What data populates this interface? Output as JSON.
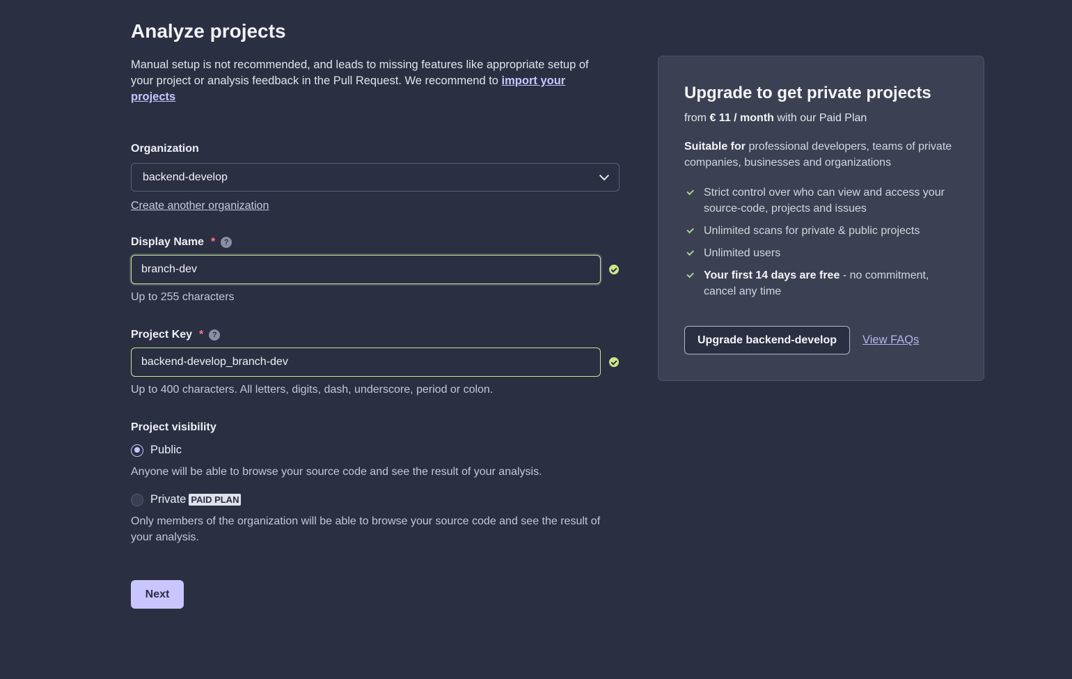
{
  "header": {
    "title": "Analyze projects"
  },
  "intro": {
    "text": "Manual setup is not recommended, and leads to missing features like appropriate setup of your project or analysis feedback in the Pull Request. We recommend to ",
    "link": "import your projects"
  },
  "organization": {
    "label": "Organization",
    "selected": "backend-develop",
    "create_link": "Create another organization"
  },
  "display_name": {
    "label": "Display Name",
    "required_mark": "*",
    "help": "?",
    "value": "branch-dev",
    "hint": "Up to 255 characters"
  },
  "project_key": {
    "label": "Project Key",
    "required_mark": "*",
    "help": "?",
    "value": "backend-develop_branch-dev",
    "hint": "Up to 400 characters. All letters, digits, dash, underscore, period or colon."
  },
  "visibility": {
    "label": "Project visibility",
    "public_label": "Public",
    "public_desc": "Anyone will be able to browse your source code and see the result of your analysis.",
    "private_label": "Private",
    "private_badge": "PAID PLAN",
    "private_desc": "Only members of the organization will be able to browse your source code and see the result of your analysis.",
    "selected": "Public"
  },
  "next_button": "Next",
  "upgrade": {
    "title": "Upgrade to get private projects",
    "price_prefix": "from ",
    "price": "€ 11 / month",
    "price_suffix": " with our Paid Plan",
    "suitable_bold": "Suitable for",
    "suitable_text": " professional developers, teams of private companies, businesses and organizations",
    "features": [
      {
        "bold": "",
        "text": "Strict control over who can view and access your source-code, projects and issues"
      },
      {
        "bold": "",
        "text": "Unlimited scans for private & public projects"
      },
      {
        "bold": "",
        "text": "Unlimited users"
      },
      {
        "bold": "Your first 14 days are free",
        "text": " - no commitment, cancel any time"
      }
    ],
    "button": "Upgrade backend-develop",
    "faq_link": "View FAQs"
  },
  "colors": {
    "background": "#2a2f42",
    "accent": "#c9c6ff",
    "valid": "#cbe88a",
    "required": "#ff7c7c"
  }
}
